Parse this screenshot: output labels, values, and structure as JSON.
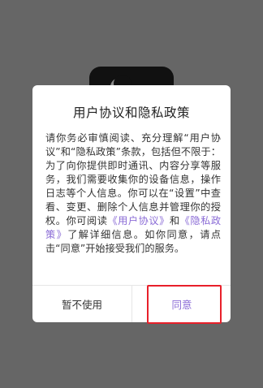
{
  "dialog": {
    "title": "用户协议和隐私政策",
    "body_before_links": "请你务必审慎阅读、充分理解“用户协议”和“隐私政策”条款，包括但不限于：为了向你提供即时通讯、内容分享等服务，我们需要收集你的设备信息，操作日志等个人信息。你可以在“设置”中查看、变更、删除个人信息并管理你的授权。你可阅读",
    "link_user_agreement": "《用户协议》",
    "between_links": "和",
    "link_privacy_policy": "《隐私政策》",
    "body_after_links": "了解详细信息。如你同意，请点击“同意”开始接受我们的服务。",
    "disagree_label": "暂不使用",
    "agree_label": "同意"
  },
  "colors": {
    "overlay": "#666666",
    "dialog_bg": "#ffffff",
    "link": "#8a6bd6",
    "agree_text": "#8a6bd6",
    "highlight": "#e8202a"
  },
  "icons": {
    "app_icon": "app-logo-icon"
  }
}
